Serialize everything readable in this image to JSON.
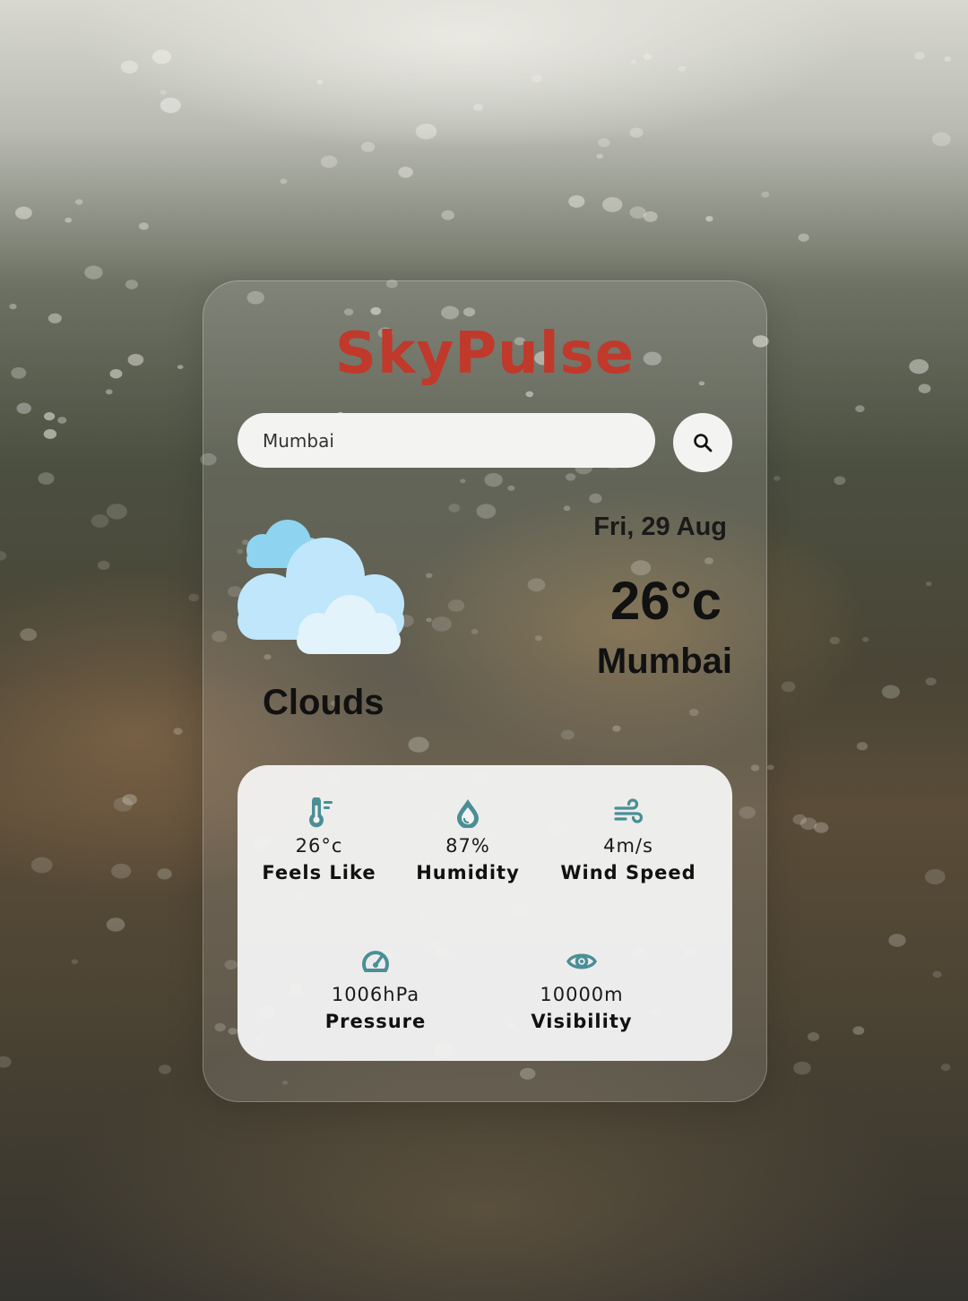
{
  "app": {
    "title": "SkyPulse"
  },
  "search": {
    "value": "Mumbai",
    "button_icon": "search-icon"
  },
  "current": {
    "icon": "clouds-icon",
    "condition": "Clouds",
    "date": "Fri, 29 Aug",
    "temperature": "26°c",
    "city": "Mumbai"
  },
  "details": {
    "items": [
      {
        "icon": "thermometer-icon",
        "value": "26°c",
        "label": "Feels Like"
      },
      {
        "icon": "droplet-icon",
        "value": "87%",
        "label": "Humidity"
      },
      {
        "icon": "wind-icon",
        "value": "4m/s",
        "label": "Wind Speed"
      },
      {
        "icon": "gauge-icon",
        "value": "1006hPa",
        "label": "Pressure"
      },
      {
        "icon": "eye-icon",
        "value": "10000m",
        "label": "Visibility"
      }
    ]
  },
  "colors": {
    "brand": "#c0392b",
    "icon_teal": "#4a8f96",
    "panel": "#f3f3f2"
  }
}
